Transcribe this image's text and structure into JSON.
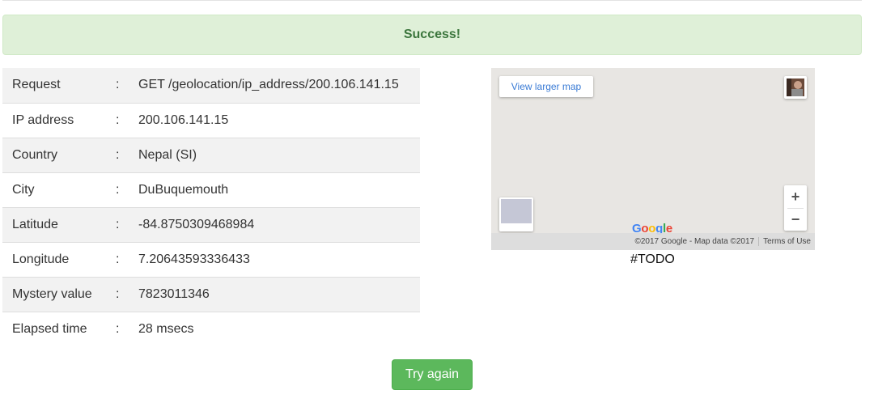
{
  "alert": {
    "message": "Success!"
  },
  "details": {
    "separator": ":",
    "rows": [
      {
        "label": "Request",
        "value": "GET /geolocation/ip_address/200.106.141.15"
      },
      {
        "label": "IP address",
        "value": "200.106.141.15"
      },
      {
        "label": "Country",
        "value": "Nepal (SI)"
      },
      {
        "label": "City",
        "value": "DuBuquemouth"
      },
      {
        "label": "Latitude",
        "value": "-84.8750309468984"
      },
      {
        "label": "Longitude",
        "value": "7.20643593336433"
      },
      {
        "label": "Mystery value",
        "value": "7823011346"
      },
      {
        "label": "Elapsed time",
        "value": "28 msecs"
      }
    ]
  },
  "map": {
    "larger_map_label": "View larger map",
    "zoom_in": "+",
    "zoom_out": "−",
    "logo_letters": [
      "G",
      "o",
      "o",
      "g",
      "l",
      "e"
    ],
    "logo_colors": [
      "#4285f4",
      "#ea4335",
      "#fbbc05",
      "#4285f4",
      "#34a853",
      "#ea4335"
    ],
    "attribution": "©2017 Google - Map data ©2017",
    "terms": "Terms of Use",
    "background_color": "#e8e6e3"
  },
  "todo_text": "#TODO",
  "try_again_label": "Try again",
  "colors": {
    "alert_bg": "#dff0d8",
    "alert_text": "#3c763d",
    "button_bg": "#5cb85c",
    "stripe": "#f2f2f2"
  }
}
